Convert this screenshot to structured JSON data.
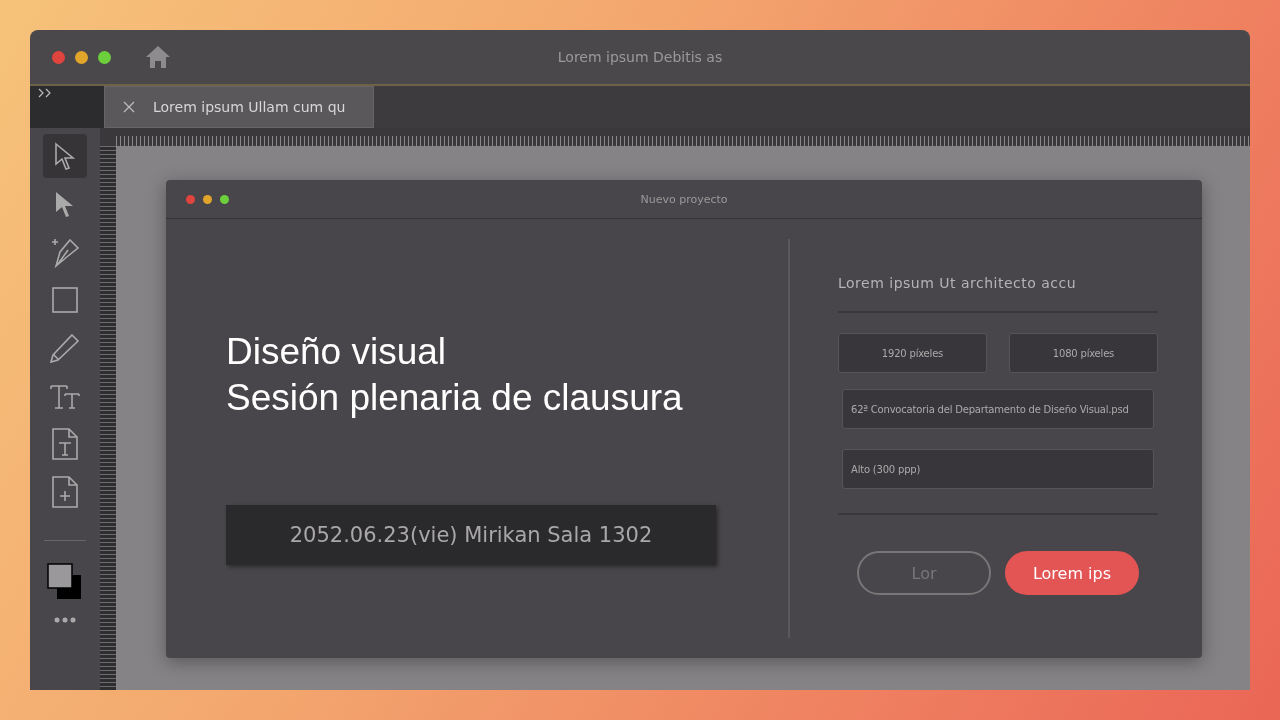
{
  "window": {
    "title": "Lorem ipsum Debitis as"
  },
  "tabs": [
    {
      "label": "Lorem ipsum Ullam cum qu",
      "selected": true
    }
  ],
  "tools": [
    {
      "kind": "select",
      "selected": true
    },
    {
      "kind": "direct-select",
      "selected": false
    },
    {
      "kind": "pen",
      "selected": false
    },
    {
      "kind": "rectangle",
      "selected": false
    },
    {
      "kind": "pencil",
      "selected": false
    },
    {
      "kind": "type",
      "selected": false
    },
    {
      "kind": "text-frame",
      "selected": false
    },
    {
      "kind": "add-page",
      "selected": false
    }
  ],
  "dialog": {
    "title": "Nuevo proyecto",
    "headline": [
      "Diseño visual",
      "Sesión plenaria de clausura"
    ],
    "info": "2052.06.23(vie) Mirikan Sala 1302",
    "section_title": "Lorem ipsum Ut architecto accu",
    "width": "1920 píxeles",
    "height": "1080 píxeles",
    "file_name": "62ª Convocatoria del Departamento de Diseño Visual.psd",
    "resolution": "Alto (300 ppp)",
    "buttons": [
      {
        "label": "Lor",
        "kind": "secondary"
      },
      {
        "label": "Lorem ips",
        "kind": "primary"
      }
    ]
  }
}
